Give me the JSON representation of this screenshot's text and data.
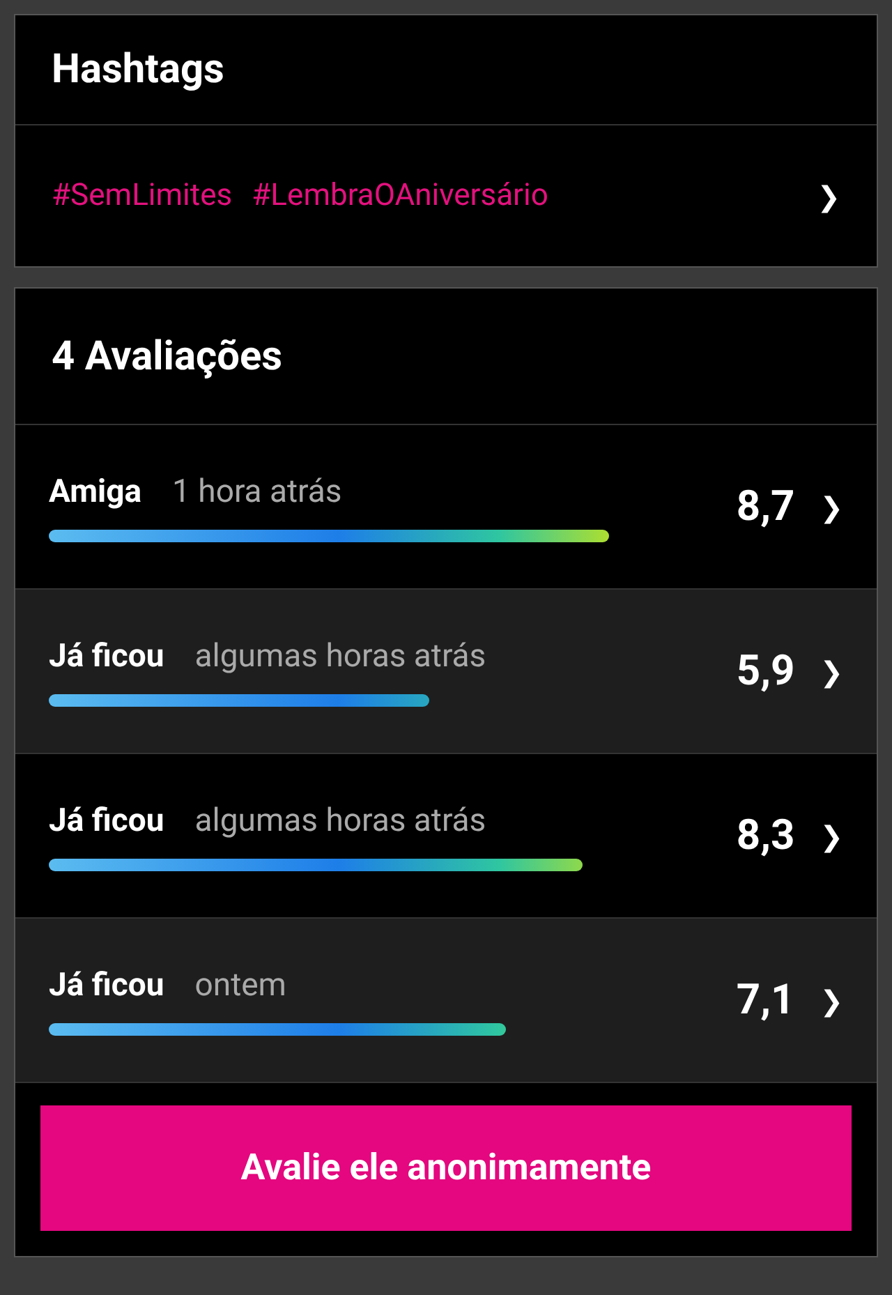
{
  "hashtags": {
    "title": "Hashtags",
    "tags": [
      "#SemLimites",
      "#LembraOAniversário"
    ],
    "chevron": "❯"
  },
  "reviews": {
    "title": "4 Avaliações",
    "items": [
      {
        "relation": "Amiga",
        "time": "1 hora atrás",
        "score": "8,7",
        "chevron": "❯"
      },
      {
        "relation": "Já ficou",
        "time": "algumas horas atrás",
        "score": "5,9",
        "chevron": "❯"
      },
      {
        "relation": "Já ficou",
        "time": "algumas horas atrás",
        "score": "8,3",
        "chevron": "❯"
      },
      {
        "relation": "Já ficou",
        "time": "ontem",
        "score": "7,1",
        "chevron": "❯"
      }
    ]
  },
  "button": "Avalie ele anonimamente"
}
